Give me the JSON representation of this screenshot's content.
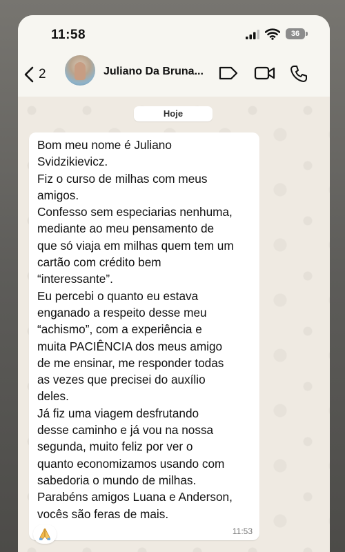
{
  "status_bar": {
    "time": "11:58",
    "battery": "36",
    "icons": [
      "signal-icon",
      "wifi-icon",
      "battery-icon"
    ]
  },
  "header": {
    "back_count": "2",
    "contact_name": "Juliano Da Bruna...",
    "icons": [
      "back-chevron-icon",
      "label-icon",
      "video-call-icon",
      "phone-call-icon"
    ]
  },
  "chat": {
    "date_label": "Hoje",
    "message": {
      "text": "Bom meu nome é Juliano\nSvidzikievicz.\nFiz o curso de milhas com meus\namigos.\nConfesso sem especiarias nenhuma,\nmediante ao meu pensamento de\nque só viaja em milhas quem tem um\ncartão com crédito bem\n“interessante”.\nEu percebi o quanto eu estava\nenganado a respeito desse meu\n“achismo”, com a experiência e\nmuita PACIÊNCIA dos meus amigo\nde me ensinar, me responder todas\nas vezes que precisei do auxílio\ndeles.\nJá fiz uma viagem desfrutando\ndesse caminho e já vou na nossa\nsegunda, muito feliz por ver o\nquanto economizamos usando com\nsabedoria o mundo de milhas.\nParabéns amigos Luana e Anderson,\nvocês são feras de mais.",
      "time": "11:53"
    },
    "reaction": "praying-hands-icon"
  },
  "colors": {
    "chat_background": "#efeae2",
    "bubble": "#ffffff",
    "header": "#f7f6f1",
    "battery": "#8c8c8c"
  }
}
